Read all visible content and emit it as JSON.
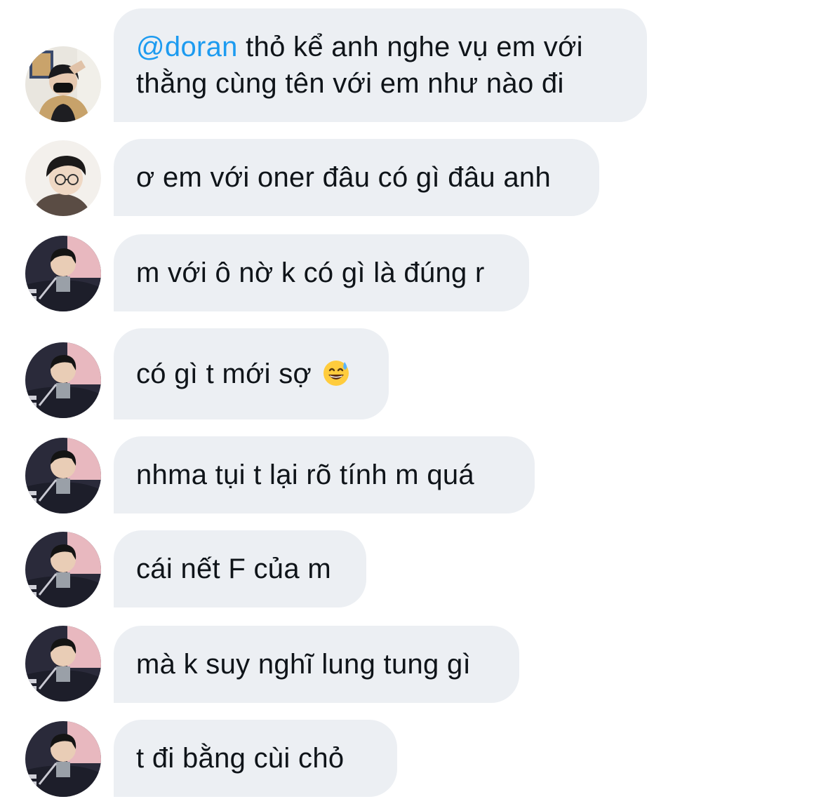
{
  "messages": [
    {
      "mention": "@doran",
      "line1_rest": " thỏ kể anh nghe vụ em với",
      "line2": "thằng cùng tên với em như nào đi"
    },
    {
      "text": "ơ em với oner đâu có gì đâu anh"
    },
    {
      "text": "m với ô nờ k có gì là đúng r"
    },
    {
      "text": "có gì t mới sợ",
      "emoji": "grinning-face-with-sweat"
    },
    {
      "text": "nhma tụi t lại rõ tính m quá"
    },
    {
      "text": "cái nết F của m"
    },
    {
      "text": "mà k suy nghĩ lung tung gì"
    },
    {
      "text": "t đi bằng cùi chỏ"
    }
  ],
  "colors": {
    "bubble": "#eceff3",
    "text": "#0f1419",
    "mention": "#1d9bf0",
    "background": "#ffffff"
  }
}
